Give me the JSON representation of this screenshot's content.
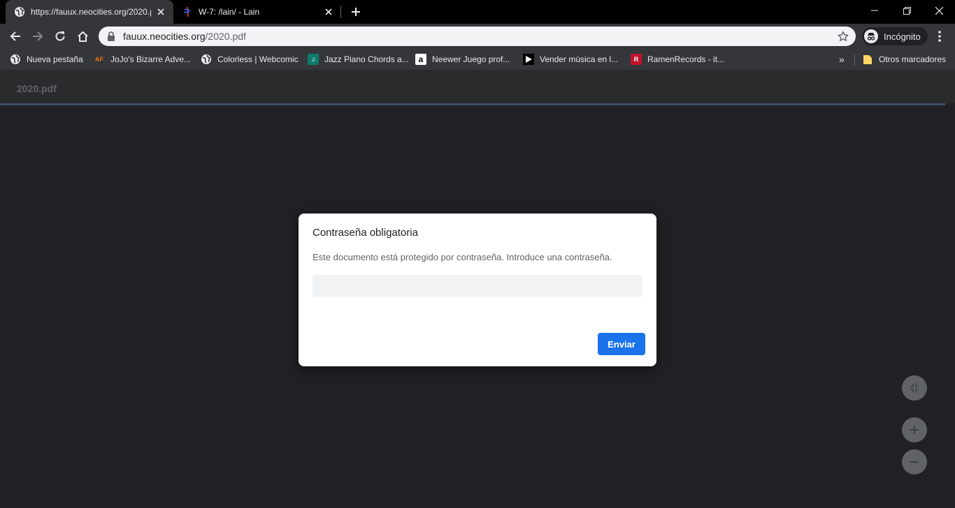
{
  "tabs": [
    {
      "title": "https://fauux.neocities.org/2020.pdf",
      "icon": "globe-icon",
      "active": true
    },
    {
      "title": "W-7: /lain/ - Lain",
      "icon": "lain-favicon",
      "active": false
    }
  ],
  "omnibox": {
    "domain": "fauux.neocities.org",
    "path": "/2020.pdf"
  },
  "profile": {
    "label": "Incógnito"
  },
  "bookmarks": [
    {
      "label": "Nueva pestaña",
      "icon": "globe-icon"
    },
    {
      "label": "JoJo's Bizarre Adve...",
      "icon": "af-icon"
    },
    {
      "label": "Colorless | Webcomic",
      "icon": "globe-icon"
    },
    {
      "label": "Jazz Piano Chords a...",
      "icon": "music-icon"
    },
    {
      "label": "Neewer Juego prof...",
      "icon": "amazon-icon"
    },
    {
      "label": "Vender música en l...",
      "icon": "play-icon"
    },
    {
      "label": "RamenRecords - it...",
      "icon": "ramen-icon"
    }
  ],
  "bookmarks_more": "»",
  "other_bookmarks": {
    "label": "Otros marcadores",
    "icon": "folder-icon"
  },
  "viewer": {
    "doc_title": "2020.pdf"
  },
  "dialog": {
    "title": "Contraseña obligatoria",
    "message": "Este documento está protegido por contraseña. Introduce una contraseña.",
    "input_value": "",
    "submit_label": "Enviar"
  },
  "colors": {
    "accent": "#1a73e8",
    "background": "#202124",
    "toolbar": "#35363a"
  }
}
